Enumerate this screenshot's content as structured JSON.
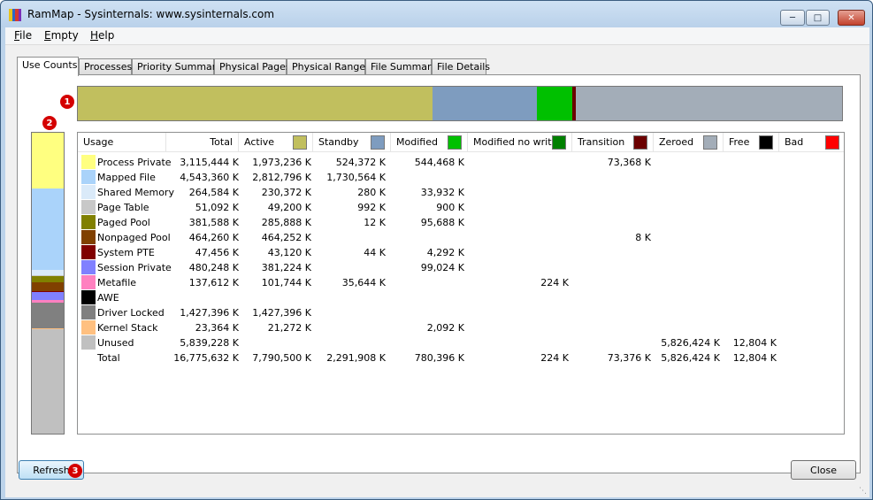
{
  "window": {
    "title": "RamMap - Sysinternals: www.sysinternals.com"
  },
  "menu": [
    "File",
    "Empty",
    "Help"
  ],
  "tabs": [
    "Use Counts",
    "Processes",
    "Priority Summary",
    "Physical Pages",
    "Physical Ranges",
    "File Summary",
    "File Details"
  ],
  "markers": [
    "1",
    "2",
    "3"
  ],
  "colors": {
    "active": "#c1bf5e",
    "standby": "#7e9cbf",
    "modified": "#00c000",
    "modified_no_write": "#008000",
    "transition": "#6b0000",
    "zeroed": "#a3adb8",
    "free": "#000000",
    "bad": "#ff0000"
  },
  "usage_bar": [
    {
      "name": "active",
      "fraction": 0.4644,
      "color": "#c1bf5e"
    },
    {
      "name": "standby",
      "fraction": 0.1366,
      "color": "#7e9cbf"
    },
    {
      "name": "modified",
      "fraction": 0.0465,
      "color": "#00c000"
    },
    {
      "name": "transition",
      "fraction": 0.0044,
      "color": "#6b0000"
    },
    {
      "name": "zeroed",
      "fraction": 0.3481,
      "color": "#a3adb8"
    }
  ],
  "type_bar": [
    {
      "name": "process-private",
      "fraction": 0.1857,
      "color": "#ffff80"
    },
    {
      "name": "mapped-file",
      "fraction": 0.2708,
      "color": "#aad3fa"
    },
    {
      "name": "shared-memory",
      "fraction": 0.0158,
      "color": "#daeaf9"
    },
    {
      "name": "page-table",
      "fraction": 0.003,
      "color": "#c8c8c8"
    },
    {
      "name": "paged-pool",
      "fraction": 0.0227,
      "color": "#808000"
    },
    {
      "name": "nonpaged-pool",
      "fraction": 0.0277,
      "color": "#804000"
    },
    {
      "name": "system-pte",
      "fraction": 0.0028,
      "color": "#800000"
    },
    {
      "name": "session-private",
      "fraction": 0.0286,
      "color": "#8080ff"
    },
    {
      "name": "metafile",
      "fraction": 0.0082,
      "color": "#ff80c0"
    },
    {
      "name": "driver-locked",
      "fraction": 0.0851,
      "color": "#808080"
    },
    {
      "name": "kernel-stack",
      "fraction": 0.0014,
      "color": "#ffc080"
    },
    {
      "name": "unused",
      "fraction": 0.3481,
      "color": "#c0c0c0"
    }
  ],
  "columns": [
    "Usage",
    "Total",
    "Active",
    "Standby",
    "Modified",
    "Modified no write",
    "Transition",
    "Zeroed",
    "Free",
    "Bad"
  ],
  "rows": [
    {
      "name": "Process Private",
      "color": "#ffff80",
      "values": [
        "3,115,444 K",
        "1,973,236 K",
        "524,372 K",
        "544,468 K",
        "",
        "73,368 K",
        "",
        "",
        ""
      ]
    },
    {
      "name": "Mapped File",
      "color": "#aad3fa",
      "values": [
        "4,543,360 K",
        "2,812,796 K",
        "1,730,564 K",
        "",
        "",
        "",
        "",
        "",
        ""
      ]
    },
    {
      "name": "Shared Memory",
      "color": "#daeaf9",
      "values": [
        "264,584 K",
        "230,372 K",
        "280 K",
        "33,932 K",
        "",
        "",
        "",
        "",
        ""
      ]
    },
    {
      "name": "Page Table",
      "color": "#c8c8c8",
      "values": [
        "51,092 K",
        "49,200 K",
        "992 K",
        "900 K",
        "",
        "",
        "",
        "",
        ""
      ]
    },
    {
      "name": "Paged Pool",
      "color": "#808000",
      "values": [
        "381,588 K",
        "285,888 K",
        "12 K",
        "95,688 K",
        "",
        "",
        "",
        "",
        ""
      ]
    },
    {
      "name": "Nonpaged Pool",
      "color": "#804000",
      "values": [
        "464,260 K",
        "464,252 K",
        "",
        "",
        "",
        "8 K",
        "",
        "",
        ""
      ]
    },
    {
      "name": "System PTE",
      "color": "#800000",
      "values": [
        "47,456 K",
        "43,120 K",
        "44 K",
        "4,292 K",
        "",
        "",
        "",
        "",
        ""
      ]
    },
    {
      "name": "Session Private",
      "color": "#8080ff",
      "values": [
        "480,248 K",
        "381,224 K",
        "",
        "99,024 K",
        "",
        "",
        "",
        "",
        ""
      ]
    },
    {
      "name": "Metafile",
      "color": "#ff80c0",
      "values": [
        "137,612 K",
        "101,744 K",
        "35,644 K",
        "",
        "224 K",
        "",
        "",
        "",
        ""
      ]
    },
    {
      "name": "AWE",
      "color": "#000000",
      "values": [
        "",
        "",
        "",
        "",
        "",
        "",
        "",
        "",
        ""
      ]
    },
    {
      "name": "Driver Locked",
      "color": "#808080",
      "values": [
        "1,427,396 K",
        "1,427,396 K",
        "",
        "",
        "",
        "",
        "",
        "",
        ""
      ]
    },
    {
      "name": "Kernel Stack",
      "color": "#ffc080",
      "values": [
        "23,364 K",
        "21,272 K",
        "",
        "2,092 K",
        "",
        "",
        "",
        "",
        ""
      ]
    },
    {
      "name": "Unused",
      "color": "#c0c0c0",
      "values": [
        "5,839,228 K",
        "",
        "",
        "",
        "",
        "",
        "5,826,424 K",
        "12,804 K",
        ""
      ]
    },
    {
      "name": "Total",
      "color": "",
      "values": [
        "16,775,632 K",
        "7,790,500 K",
        "2,291,908 K",
        "780,396 K",
        "224 K",
        "73,376 K",
        "5,826,424 K",
        "12,804 K",
        ""
      ]
    }
  ],
  "buttons": {
    "refresh": "Refresh",
    "close": "Close"
  }
}
